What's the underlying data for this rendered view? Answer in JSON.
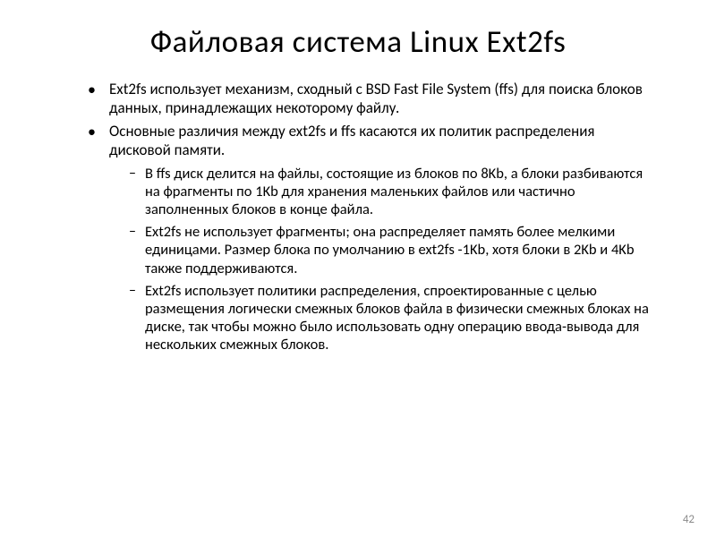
{
  "slide": {
    "title": "Файловая система Linux Ext2fs",
    "bullets": [
      {
        "text": "Ext2fs использует механизм, сходный с BSD Fast File System (ffs) для поиска блоков данных, принадлежащих некоторому файлу."
      },
      {
        "text": "Основные различия между ext2fs и ffs касаются их политик распределения дисковой памяти.",
        "sub": [
          "В ffs диск делится на файлы, состоящие из блоков по 8Kb, а блоки разбиваются на фрагменты по 1Kb для хранения маленьких файлов или  частично заполненных блоков в конце файла.",
          "Ext2fs не использует фрагменты; она распределяет память более мелкими единицами.  Размер блока по умолчанию в ext2fs -1Kb, хотя блоки в 2Kb и 4Kb также поддерживаются.",
          "Ext2fs использует политики распределения, спроектированные с целью размещения логически смежных блоков файла в физически смежных блоках на диске, так чтобы можно было использовать одну операцию ввода-вывода для нескольких смежных блоков."
        ]
      }
    ],
    "page_number": "42"
  }
}
